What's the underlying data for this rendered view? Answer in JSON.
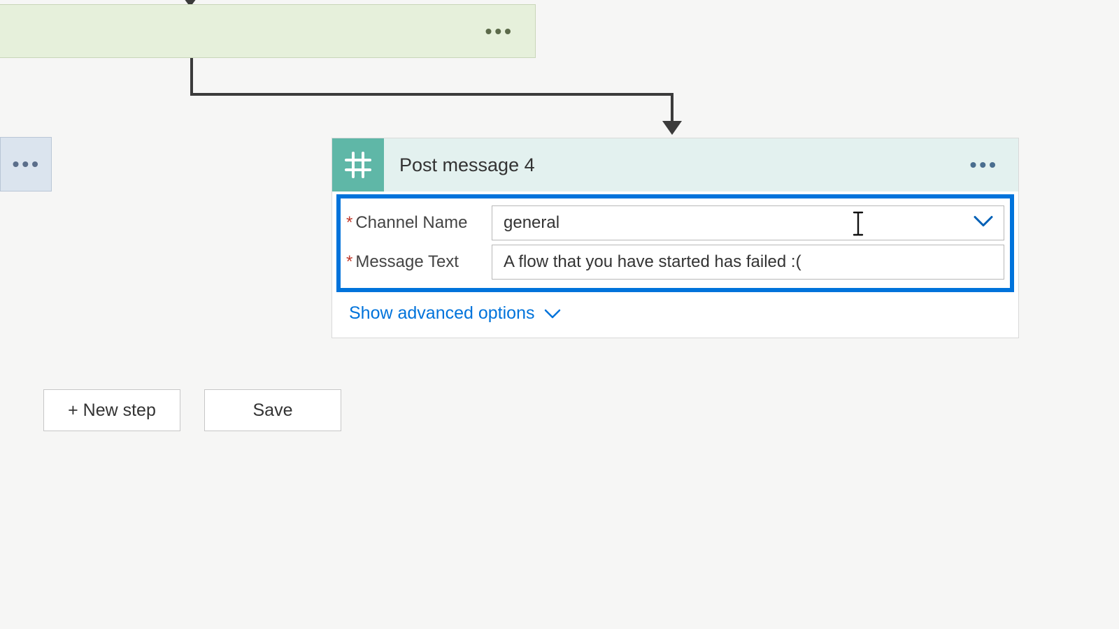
{
  "card": {
    "title": "Post message 4",
    "fields": {
      "channel": {
        "label": "Channel Name",
        "value": "general"
      },
      "message": {
        "label": "Message Text",
        "value": "A flow that you have started has failed :("
      }
    },
    "advanced": "Show advanced options"
  },
  "buttons": {
    "new_step": "+ New step",
    "save": "Save"
  }
}
